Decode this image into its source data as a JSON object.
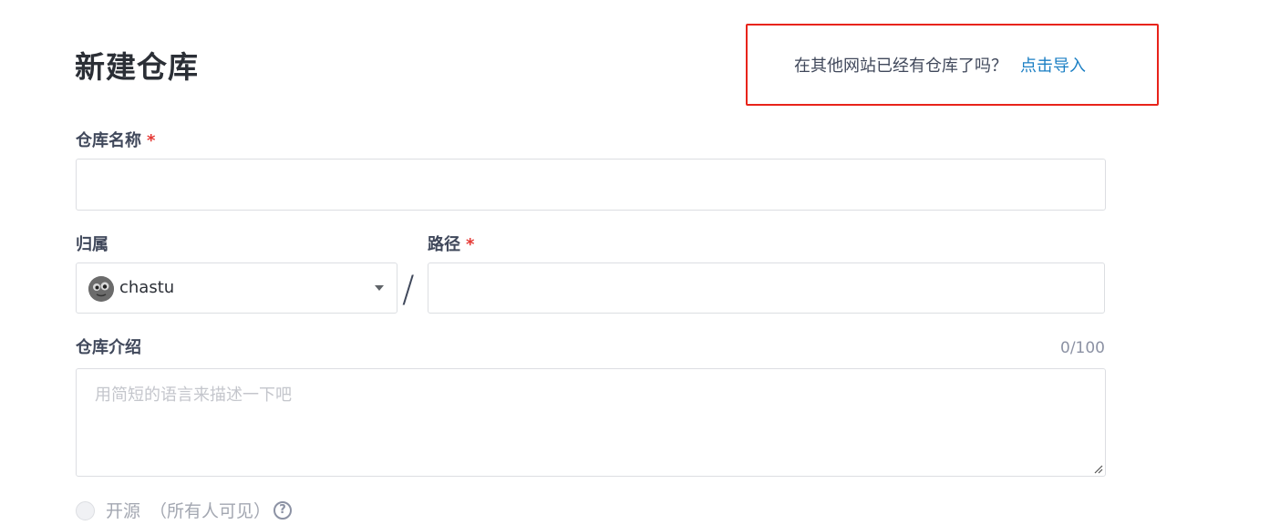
{
  "page": {
    "title": "新建仓库"
  },
  "import_prompt": {
    "text": "在其他网站已经有仓库了吗？",
    "link_label": "点击导入",
    "link_color": "#1b7fc4",
    "highlight_border_color": "#e8231a"
  },
  "form": {
    "repo_name": {
      "label": "仓库名称",
      "required_mark": "*",
      "value": ""
    },
    "owner": {
      "label": "归属",
      "selected_value": "chastu",
      "avatar_icon": "avatar-icon"
    },
    "path_separator": "/",
    "path": {
      "label": "路径",
      "required_mark": "*",
      "value": ""
    },
    "description": {
      "label": "仓库介绍",
      "counter": "0/100",
      "placeholder": "用简短的语言来描述一下吧",
      "value": ""
    },
    "visibility": {
      "option_label": "开源",
      "option_note": "（所有人可见）",
      "help_icon": "question-circle-icon",
      "help_symbol": "?"
    }
  },
  "colors": {
    "text_primary": "#40485b",
    "required_star": "#e53935",
    "muted": "#a3a7b1"
  }
}
